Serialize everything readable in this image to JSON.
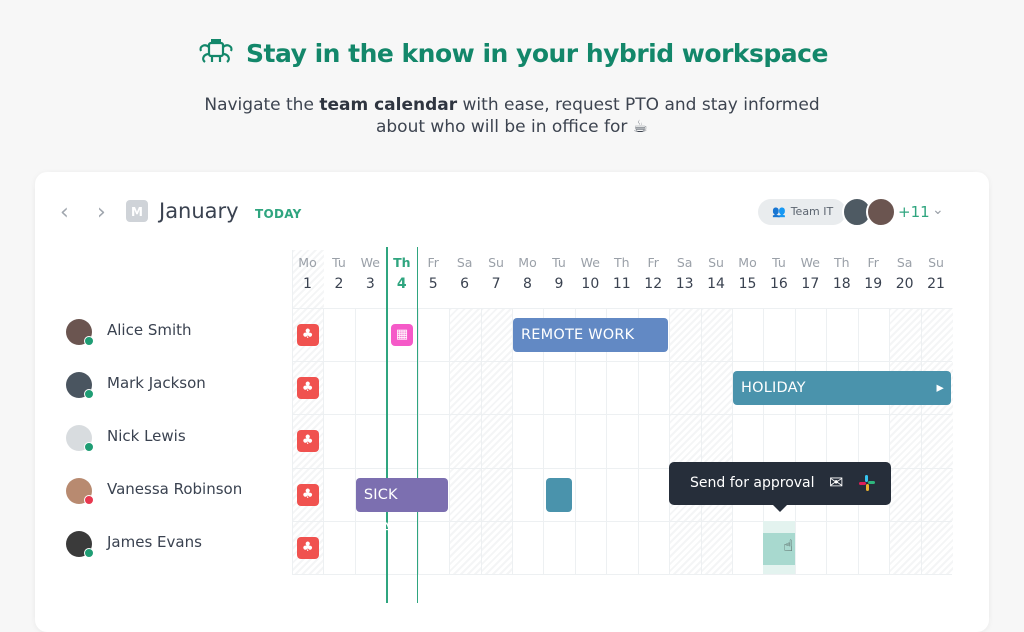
{
  "hero": {
    "title": "Stay in the know in your hybrid workspace",
    "subtitle_pre": "Navigate the ",
    "subtitle_bold": "team calendar",
    "subtitle_post": " with ease, request PTO and stay informed",
    "subtitle_line2": "about who will be in office for",
    "emoji": "☕"
  },
  "calendar": {
    "month": "January",
    "month_icon_letter": "M",
    "today_label": "TODAY",
    "team_label": "Team IT",
    "more_count": "+11",
    "today_day": 4,
    "days": [
      [
        "Mo",
        "1"
      ],
      [
        "Tu",
        "2"
      ],
      [
        "We",
        "3"
      ],
      [
        "Th",
        "4"
      ],
      [
        "Fr",
        "5"
      ],
      [
        "Sa",
        "6"
      ],
      [
        "Su",
        "7"
      ],
      [
        "Mo",
        "8"
      ],
      [
        "Tu",
        "9"
      ],
      [
        "We",
        "10"
      ],
      [
        "Th",
        "11"
      ],
      [
        "Fr",
        "12"
      ],
      [
        "Sa",
        "13"
      ],
      [
        "Su",
        "14"
      ],
      [
        "Mo",
        "15"
      ],
      [
        "Tu",
        "16"
      ],
      [
        "We",
        "17"
      ],
      [
        "Th",
        "18"
      ],
      [
        "Fr",
        "19"
      ],
      [
        "Sa",
        "20"
      ],
      [
        "Su",
        "21"
      ]
    ],
    "hatched_days": [
      1,
      6,
      7,
      13,
      14,
      20,
      21
    ],
    "people": [
      {
        "name": "Alice Smith",
        "status_color": "#1f9d74",
        "avatar_color": "#6b5550"
      },
      {
        "name": "Mark Jackson",
        "status_color": "#1f9d74",
        "avatar_color": "#4a5560"
      },
      {
        "name": "Nick Lewis",
        "status_color": "#1f9d74",
        "avatar_color": "#d8dcdf"
      },
      {
        "name": "Vanessa Robinson",
        "status_color": "#e8384f",
        "avatar_color": "#b88a70"
      },
      {
        "name": "James Evans",
        "status_color": "#1f9d74",
        "avatar_color": "#3a3a3a"
      }
    ],
    "events": [
      {
        "row": 0,
        "start": 1,
        "end": 1,
        "type": "holiday-icon",
        "color": "#f0524f"
      },
      {
        "row": 1,
        "start": 1,
        "end": 1,
        "type": "holiday-icon",
        "color": "#f0524f"
      },
      {
        "row": 2,
        "start": 1,
        "end": 1,
        "type": "holiday-icon",
        "color": "#f0524f"
      },
      {
        "row": 3,
        "start": 1,
        "end": 1,
        "type": "holiday-icon",
        "color": "#f0524f"
      },
      {
        "row": 4,
        "start": 1,
        "end": 1,
        "type": "holiday-icon",
        "color": "#f0524f"
      },
      {
        "row": 0,
        "start": 4,
        "end": 4,
        "type": "birthday-icon",
        "color": "#f55ac8"
      },
      {
        "row": 0,
        "start": 8,
        "end": 12,
        "type": "bar",
        "label": "REMOTE WORK",
        "color": "#6289c4"
      },
      {
        "row": 1,
        "start": 15,
        "end": 21,
        "type": "bar",
        "label": "HOLIDAY",
        "color": "#4a93ac",
        "continues": true
      },
      {
        "row": 3,
        "start": 3,
        "end": 5,
        "type": "bar",
        "label": "SICK LEAVE",
        "color": "#7c6fb0"
      },
      {
        "row": 3,
        "start": 9,
        "end": 9,
        "type": "small",
        "color": "#4a93ac"
      },
      {
        "row": 4,
        "start": 16,
        "end": 16,
        "type": "selection",
        "color": "#a8d9cf"
      }
    ],
    "tooltip": {
      "label": "Send for approval",
      "icons": [
        "mail-icon",
        "slack-icon"
      ]
    }
  }
}
